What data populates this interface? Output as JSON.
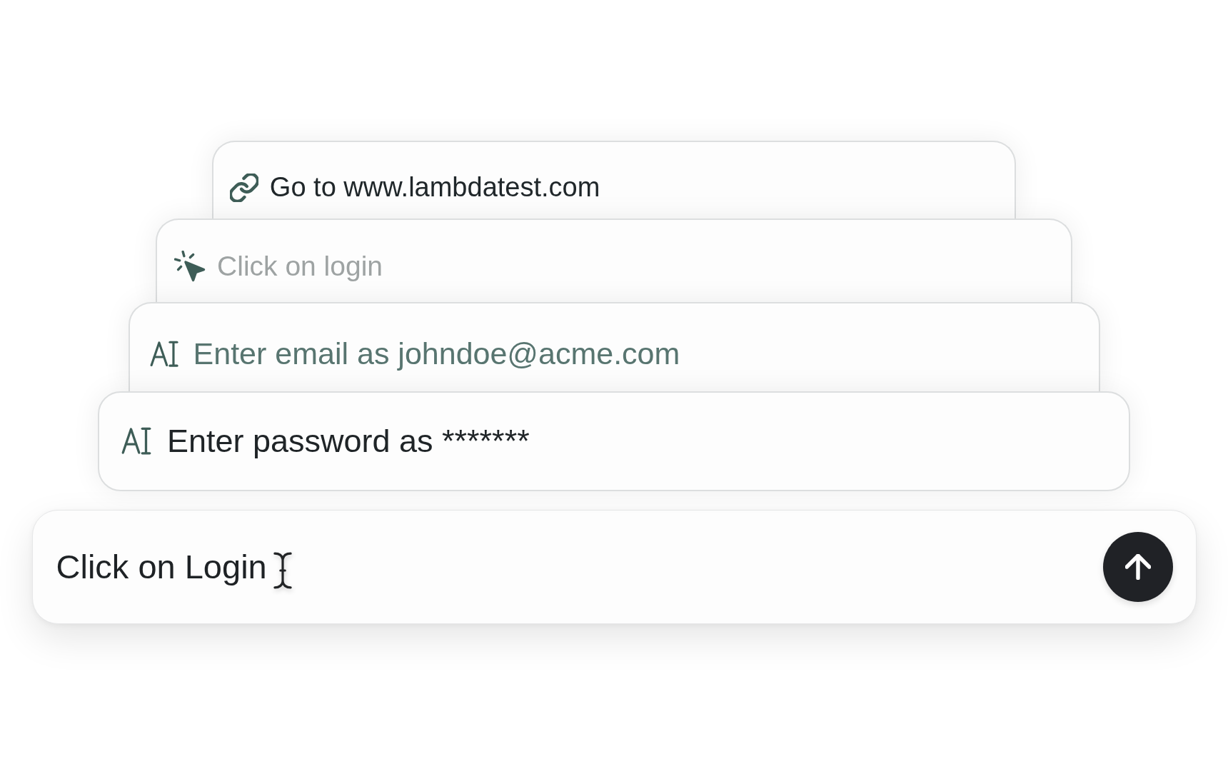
{
  "steps": [
    {
      "kind": "navigate",
      "text": "Go to www.lambdatest.com",
      "color": "#20272a"
    },
    {
      "kind": "click",
      "text": "Click on login",
      "color": "#9ea3a3"
    },
    {
      "kind": "type",
      "text": "Enter email as johndoe@acme.com",
      "color": "#587570"
    },
    {
      "kind": "type",
      "text": "Enter password as *******",
      "color": "#1f2427"
    }
  ],
  "prompt_field": {
    "value": "Click on Login"
  }
}
